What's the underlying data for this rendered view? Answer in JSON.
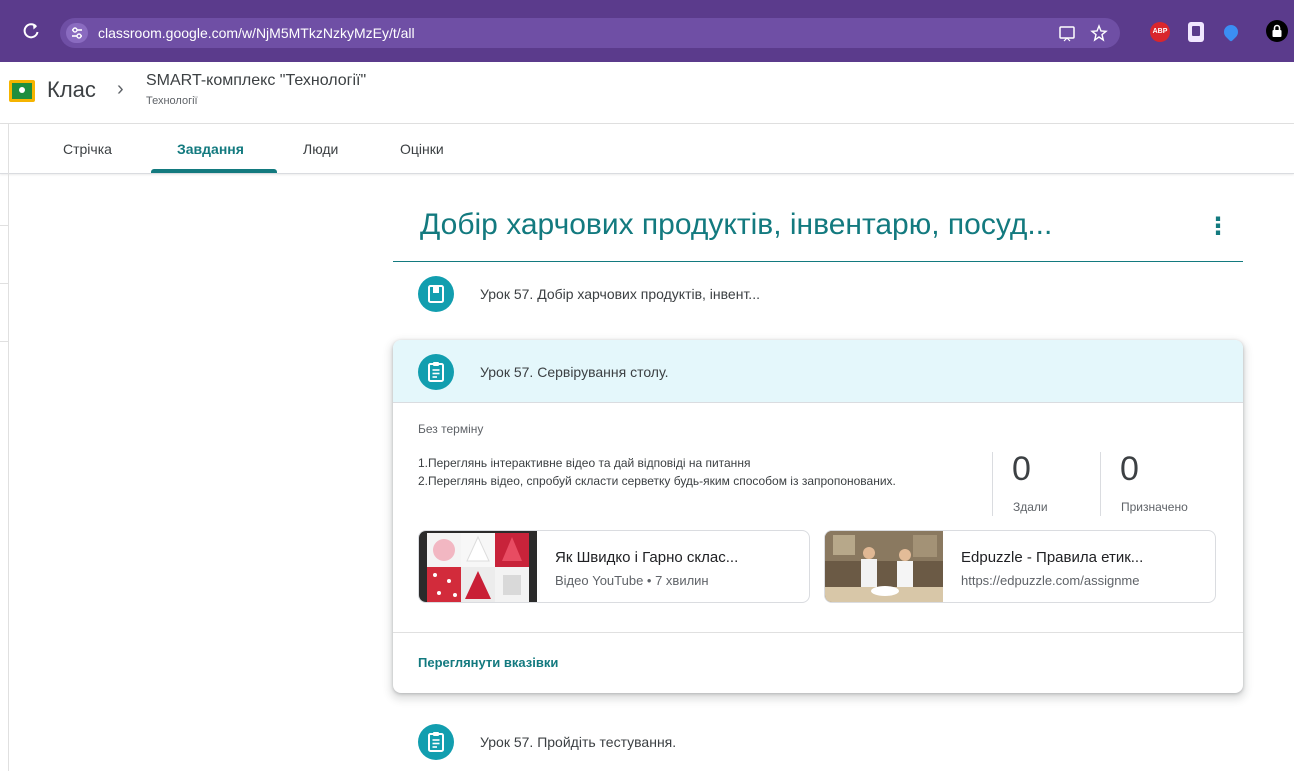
{
  "browser": {
    "url": "classroom.google.com/w/NjM5MTkzNzkyMzEy/t/all",
    "extensions": [
      "reload-icon",
      "site-info-icon",
      "cast-icon",
      "star-icon",
      "adblock-icon",
      "book-icon",
      "shield-icon",
      "lock-icon"
    ],
    "abp_label": "ABP"
  },
  "header": {
    "class_label": "Клас",
    "course_title": "SMART-комплекс \"Технології\"",
    "course_subtitle": "Технології"
  },
  "tabs": [
    {
      "label": "Стрічка"
    },
    {
      "label": "Завдання"
    },
    {
      "label": "Люди"
    },
    {
      "label": "Оцінки"
    }
  ],
  "active_tab": "Завдання",
  "topic": {
    "title": "Добір харчових продуктів, інвентарю, посуд..."
  },
  "items": [
    {
      "title": "Урок 57. Добір харчових продуктів, інвент...",
      "icon": "material-icon"
    },
    {
      "title": "Урок 57. Сервірування столу.",
      "icon": "assignment-icon"
    },
    {
      "title": "Урок 57. Пройдіть тестування.",
      "icon": "assignment-icon"
    }
  ],
  "expanded": {
    "due": "Без терміну",
    "description_line1": "1.Переглянь інтерактивне відео та дай відповіді на питання",
    "description_line2": "2.Переглянь відео, спробуй скласти серветку будь-яким способом із запропонованих.",
    "stats": [
      {
        "value": "0",
        "label": "Здали"
      },
      {
        "value": "0",
        "label": "Призначено"
      }
    ],
    "attachments": [
      {
        "title": "Як Швидко і Гарно склас...",
        "subtitle": "Відео YouTube • 7 хвилин"
      },
      {
        "title": "Edpuzzle - Правила етик...",
        "subtitle": "https://edpuzzle.com/assignme"
      }
    ],
    "view_link": "Переглянути вказівки"
  },
  "colors": {
    "accent": "#137a7f",
    "icon_bg": "#129eaf",
    "browser_bar": "#5b3b8c",
    "card_head": "#e4f7fb"
  }
}
